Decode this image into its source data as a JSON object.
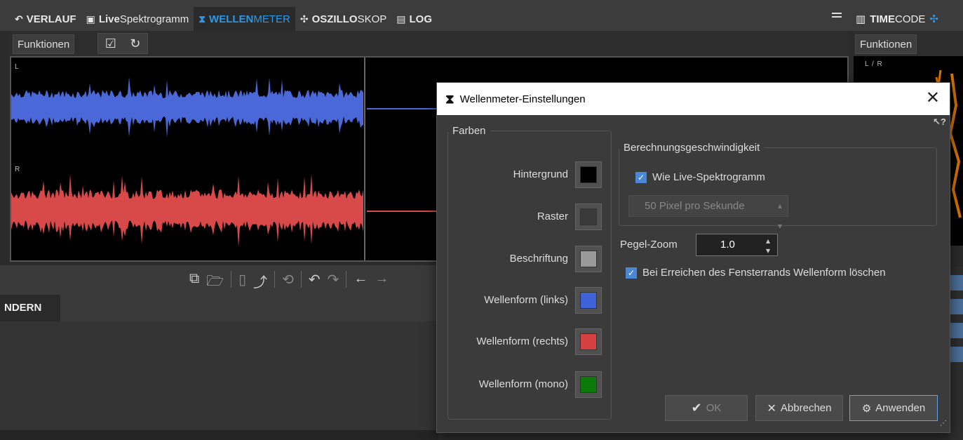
{
  "tabs": [
    {
      "icon": "↶",
      "bold": "VERLAUF",
      "thin": ""
    },
    {
      "icon": "▣",
      "bold": "Live",
      "thin": "Spektrogramm"
    },
    {
      "icon": "⧗",
      "bold": "WELLEN",
      "thin": "METER"
    },
    {
      "icon": "✣",
      "bold": "OSZILLO",
      "thin": "SKOP"
    },
    {
      "icon": "▤",
      "bold": "LOG",
      "thin": ""
    }
  ],
  "right_tab": {
    "icon": "▥",
    "bold": "TIME",
    "thin": "CODE"
  },
  "left_panel": {
    "functions_label": "Funktionen",
    "channel_left": "L",
    "channel_right": "R",
    "lower_tab_label": "NDERN"
  },
  "right_panel": {
    "functions_label": "Funktionen",
    "channel_label": "L / R"
  },
  "dialog": {
    "title": "Wellenmeter-Einstellungen",
    "colors_group": "Farben",
    "colors": [
      {
        "label": "Hintergrund",
        "color": "#000000"
      },
      {
        "label": "Raster",
        "color": "#3a3a3a"
      },
      {
        "label": "Beschriftung",
        "color": "#9a9a9a"
      },
      {
        "label": "Wellenform (links)",
        "color": "#3f62d6"
      },
      {
        "label": "Wellenform (rechts)",
        "color": "#d64040"
      },
      {
        "label": "Wellenform (mono)",
        "color": "#0b7a0b"
      }
    ],
    "speed_group": "Berechnungsgeschwindigkeit",
    "speed_checkbox": "Wie Live-Spektrogramm",
    "speed_checkbox_checked": true,
    "speed_value": "50 Pixel pro Sekunde",
    "zoom_label": "Pegel-Zoom",
    "zoom_value": "1.0",
    "clear_checkbox": "Bei Erreichen des Fensterrands Wellenform löschen",
    "clear_checkbox_checked": true,
    "ok_label": "OK",
    "cancel_label": "Abbrechen",
    "apply_label": "Anwenden"
  },
  "colors": {
    "accent": "#2e98e8",
    "waveform_left": "#4a68d8",
    "waveform_right": "#d84a4a",
    "timecode_trace": "#ff8c00"
  }
}
